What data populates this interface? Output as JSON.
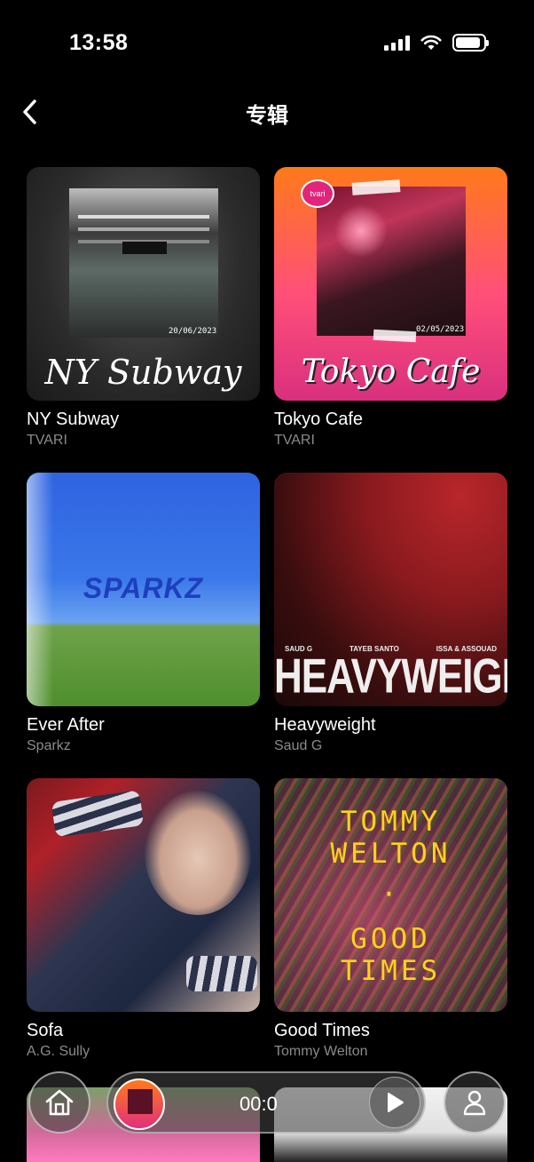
{
  "status_bar": {
    "time": "13:58",
    "battery_level": 0.9
  },
  "nav": {
    "title": "专辑",
    "back_icon": "chevron-left-icon"
  },
  "albums": [
    {
      "title": "NY Subway",
      "artist": "TVARI",
      "cover_text": "NY Subway",
      "cover_date": "20/06/2023"
    },
    {
      "title": "Tokyo Cafe",
      "artist": "TVARI",
      "cover_text": "Tokyo Cafe",
      "cover_date": "02/05/2023",
      "cover_badge": "tvari"
    },
    {
      "title": "Ever After",
      "artist": "Sparkz",
      "cover_text": "SPARKZ"
    },
    {
      "title": "Heavyweight",
      "artist": "Saud G",
      "cover_text": "HEAVYWEIGHT",
      "cover_credits": [
        "SAUD G",
        "TAYEB SANTO",
        "ISSA & ASSOUAD"
      ]
    },
    {
      "title": "Sofa",
      "artist": "A.G. Sully"
    },
    {
      "title": "Good Times",
      "artist": "Tommy Welton",
      "cover_lines": [
        "TOMMY",
        "WELTON",
        "·",
        "GOOD",
        "TIMES"
      ]
    }
  ],
  "player": {
    "time": "00:0",
    "play_icon": "play-icon"
  },
  "bottom_nav": {
    "home_icon": "home-icon",
    "profile_icon": "user-icon"
  },
  "colors": {
    "background": "#000000",
    "secondary_text": "#8a8a8a",
    "good_times_text": "#ffd21a"
  }
}
